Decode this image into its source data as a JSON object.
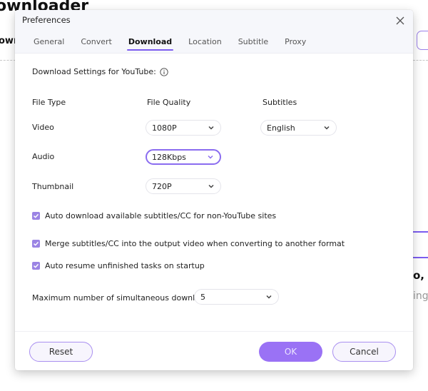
{
  "background": {
    "title_fragment": "ownloader",
    "subtitle_fragment": "own",
    "right_bold_fragment": "o, c",
    "right_gray_fragment": "ing."
  },
  "dialog": {
    "title": "Preferences",
    "tabs": [
      {
        "label": "General",
        "active": false
      },
      {
        "label": "Convert",
        "active": false
      },
      {
        "label": "Download",
        "active": true
      },
      {
        "label": "Location",
        "active": false
      },
      {
        "label": "Subtitle",
        "active": false
      },
      {
        "label": "Proxy",
        "active": false
      }
    ],
    "section_title": "Download Settings for YouTube:",
    "columns": {
      "file_type": "File Type",
      "file_quality": "File Quality",
      "subtitles": "Subtitles"
    },
    "rows": {
      "video": {
        "label": "Video",
        "quality": "1080P",
        "subtitle": "English"
      },
      "audio": {
        "label": "Audio",
        "quality": "128Kbps"
      },
      "thumbnail": {
        "label": "Thumbnail",
        "quality": "720P"
      }
    },
    "checkboxes": [
      {
        "label": "Auto download available subtitles/CC for non-YouTube sites",
        "checked": true
      },
      {
        "label": "Merge subtitles/CC into the output video when converting to another format",
        "checked": true
      },
      {
        "label": "Auto resume unfinished tasks on startup",
        "checked": true
      }
    ],
    "max_downloads": {
      "label": "Maximum number of simultaneous downloads:",
      "value": "5"
    },
    "buttons": {
      "reset": "Reset",
      "ok": "OK",
      "cancel": "Cancel"
    }
  },
  "colors": {
    "accent": "#7b5cf0",
    "primary_button": "#9a72f5",
    "checkbox": "#9b84e4"
  }
}
